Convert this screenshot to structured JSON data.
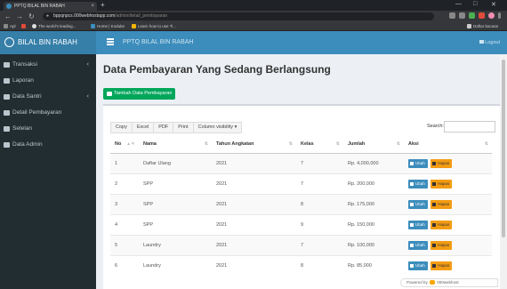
{
  "browser": {
    "tab_title": "PPTQ BILAL BIN RABAH",
    "tab_close": "×",
    "new_tab": "+",
    "url_host": "bppqnpcs.000webhostapp.com",
    "url_path": "/admin/detail_pembayaran",
    "bookmarks": [
      {
        "label": "Apl",
        "color": "#888"
      },
      {
        "label": "",
        "color": "#e04b3a"
      },
      {
        "label": "The world's leading...",
        "color": "#ddd"
      },
      {
        "label": "Home | Kodular",
        "color": "#3c8dbc"
      },
      {
        "label": "Learn how to use Ti...",
        "color": "#f4b400"
      }
    ],
    "reading_list": "Daftar bacaan"
  },
  "brand": "BILAL BIN RABAH",
  "sidebar": {
    "items": [
      {
        "label": "Transaksi",
        "has_children": true
      },
      {
        "label": "Laporan",
        "has_children": false
      },
      {
        "label": "Data Santri",
        "has_children": true
      },
      {
        "label": "Detail Pembayaran",
        "has_children": false
      },
      {
        "label": "Setelan",
        "has_children": false
      },
      {
        "label": "Data Admin",
        "has_children": false
      }
    ]
  },
  "topnav": {
    "title": "PPTQ BILAL BIN RABAH",
    "logout": "Logout"
  },
  "main": {
    "title": "Data Pembayaran Yang Sedang Berlangsung",
    "add_button": "Tambah Data Pembayaran",
    "toolbar": [
      "Copy",
      "Excel",
      "PDF",
      "Print",
      "Column visibility ▾"
    ],
    "search_label": "Search:",
    "columns": [
      "No",
      "Nama",
      "Tahun Angkatan",
      "Kelas",
      "Jumlah",
      "Aksi"
    ],
    "edit_label": "Ubah",
    "delete_label": "Hapus",
    "rows": [
      {
        "no": "1",
        "nama": "Daftar Ulang",
        "tahun": "2021",
        "kelas": "7",
        "jumlah": "Rp. 4,000,000"
      },
      {
        "no": "2",
        "nama": "SPP",
        "tahun": "2021",
        "kelas": "7",
        "jumlah": "Rp. 200,000"
      },
      {
        "no": "3",
        "nama": "SPP",
        "tahun": "2021",
        "kelas": "8",
        "jumlah": "Rp. 175,000"
      },
      {
        "no": "4",
        "nama": "SPP",
        "tahun": "2021",
        "kelas": "9",
        "jumlah": "Rp. 150,000"
      },
      {
        "no": "5",
        "nama": "Laundry",
        "tahun": "2021",
        "kelas": "7",
        "jumlah": "Rp. 100,000"
      },
      {
        "no": "6",
        "nama": "Laundry",
        "tahun": "2021",
        "kelas": "8",
        "jumlah": "Rp. 85,000"
      }
    ]
  },
  "footer": {
    "powered_by": "Powered by",
    "host": "000webhost"
  }
}
